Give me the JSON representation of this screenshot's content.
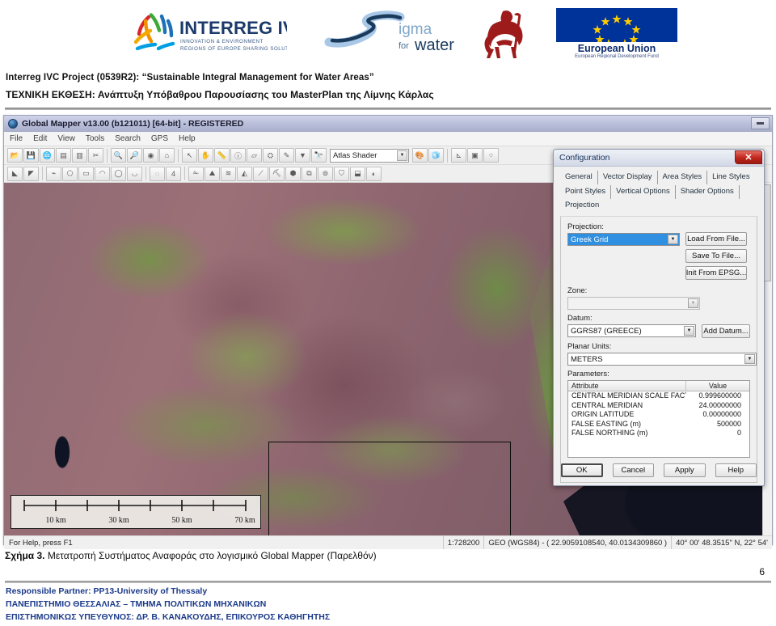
{
  "header": {
    "logos": [
      {
        "name": "interreg-ivc-logo",
        "main": "INTERREG IVC",
        "sub1": "INNOVATION & ENVIRONMENT",
        "sub2": "REGIONS OF EUROPE SHARING SOLUTIONS"
      },
      {
        "name": "sigma-for-water-logo",
        "main": "igma",
        "sub1": "for",
        "sub2": "water"
      },
      {
        "name": "university-of-thessaly-logo",
        "main": "",
        "sub1": "",
        "sub2": ""
      },
      {
        "name": "european-union-logo",
        "main": "European Union",
        "sub1": "European Regional Development Fund",
        "sub2": ""
      }
    ]
  },
  "document": {
    "title_line1": "Interreg IVC Project (0539R2): “Sustainable Integral Management for Water Areas”",
    "title_line2": "ΤΕΧΝΙΚΗ  ΕΚΘΕΣΗ: Ανάπτυξη Υπόβαθρου Παρουσίασης του MasterPlan της Λίμνης Κάρλας",
    "caption_bold": "Σχήμα 3.",
    "caption_rest": " Μετατροπή Συστήματος Αναφοράς στο λογισμικό Global Mapper (Παρελθόν)",
    "page_number": "6"
  },
  "footer": {
    "line1": "Responsible Partner: PP13-University of Thessaly",
    "line2": "ΠΑΝΕΠΙΣΤΗΜΙΟ ΘΕΣΣΑΛΙΑΣ – ΤΜΗΜΑ ΠΟΛΙΤΙΚΩΝ ΜΗΧΑΝΙΚΩΝ",
    "line3": "ΕΠΙΣΤΗΜΟΝΙΚΩΣ ΥΠΕΥΘΥΝΟΣ: ΔΡ. Β. ΚΑΝΑΚΟΥΔΗΣ, ΕΠΙΚΟΥΡΟΣ ΚΑΘΗΓΗΤΗΣ"
  },
  "app": {
    "title": "Global Mapper v13.00 (b121011) [64-bit] - REGISTERED",
    "menu": [
      "File",
      "Edit",
      "View",
      "Tools",
      "Search",
      "GPS",
      "Help"
    ],
    "toolbar": {
      "shader_value": "Atlas Shader",
      "row1_icons": [
        "open-file-icon",
        "save-file-icon",
        "globe-icon",
        "layer-control-icon",
        "overlay-icon",
        "tools-icon",
        "zoom-in-icon",
        "zoom-out-icon",
        "zoom-to-layer-icon",
        "home-extents-icon",
        "pan-pointer-icon",
        "grab-hand-icon",
        "measure-icon",
        "feature-info-icon",
        "digitizer-icon",
        "path-profile-icon",
        "line-draw-icon",
        "shader-dropdown-icon",
        "find-binoculars-icon",
        "shader-settings-icon",
        "3d-view-icon",
        "grid-tool-icon",
        "image-rectify-icon",
        "scatter-icon"
      ],
      "row2_icons": [
        "area-create-icon",
        "line-create-icon",
        "point-create-icon",
        "polygon-icon",
        "rectangle-icon",
        "circle-icon",
        "ellipse-icon",
        "arc-icon",
        "range-ring-icon",
        "contour-icon",
        "cut-polygon-icon",
        "terrain-icon",
        "watershed-icon",
        "view-shed-icon",
        "line-of-sight-icon",
        "3d-path-icon",
        "volume-icon",
        "combine-terrain-icon",
        "generate-contours-icon",
        "elevation-icon",
        "flatten-icon",
        "spatial-op-icon"
      ]
    },
    "statusbar": {
      "help_text": "For Help, press F1",
      "scale": "1:728200",
      "coords_projected": "GEO (WGS84) - ( 22.9059108540, 40.0134309860 )",
      "coords_dms": "40° 00' 48.3515\" N, 22° 54'"
    },
    "map": {
      "scalebar_labels": [
        "10 km",
        "30 km",
        "50 km",
        "70 km"
      ],
      "scalebar_name": "map-scale-bar"
    },
    "window_buttons": [
      "restore-button"
    ]
  },
  "dialog": {
    "title": "Configuration",
    "close_label": "✕",
    "tabs_row1": [
      "General",
      "Vector Display",
      "Area Styles",
      "Line Styles"
    ],
    "tabs_row2": [
      "Point Styles",
      "Vertical Options",
      "Shader Options",
      "Projection"
    ],
    "active_tab": "Projection",
    "fields": {
      "projection_label": "Projection:",
      "projection_value": "Greek Grid",
      "zone_label": "Zone:",
      "zone_value": "",
      "datum_label": "Datum:",
      "datum_value": "GGRS87 (GREECE)",
      "planar_units_label": "Planar Units:",
      "planar_units_value": "METERS",
      "parameters_label": "Parameters:"
    },
    "side_buttons": [
      "Load From File...",
      "Save To File...",
      "Init From EPSG...",
      "Add Datum..."
    ],
    "parameters_table": {
      "headers": [
        "Attribute",
        "Value"
      ],
      "rows": [
        {
          "attribute": "CENTRAL MERIDIAN SCALE FACT...",
          "value": "0.999600000"
        },
        {
          "attribute": "CENTRAL MERIDIAN",
          "value": "24.00000000"
        },
        {
          "attribute": "ORIGIN LATITUDE",
          "value": "0.00000000"
        },
        {
          "attribute": "FALSE EASTING (m)",
          "value": "500000"
        },
        {
          "attribute": "FALSE NORTHING (m)",
          "value": "0"
        }
      ]
    },
    "buttons": [
      "OK",
      "Cancel",
      "Apply",
      "Help"
    ]
  },
  "colors": {
    "dialog_accent": "#2f8fe0",
    "close_red": "#c0261c",
    "title_blue": "#16325c",
    "footer_blue": "#1b3a8a",
    "eu_blue": "#003399",
    "uth_red": "#9e1b1b"
  }
}
